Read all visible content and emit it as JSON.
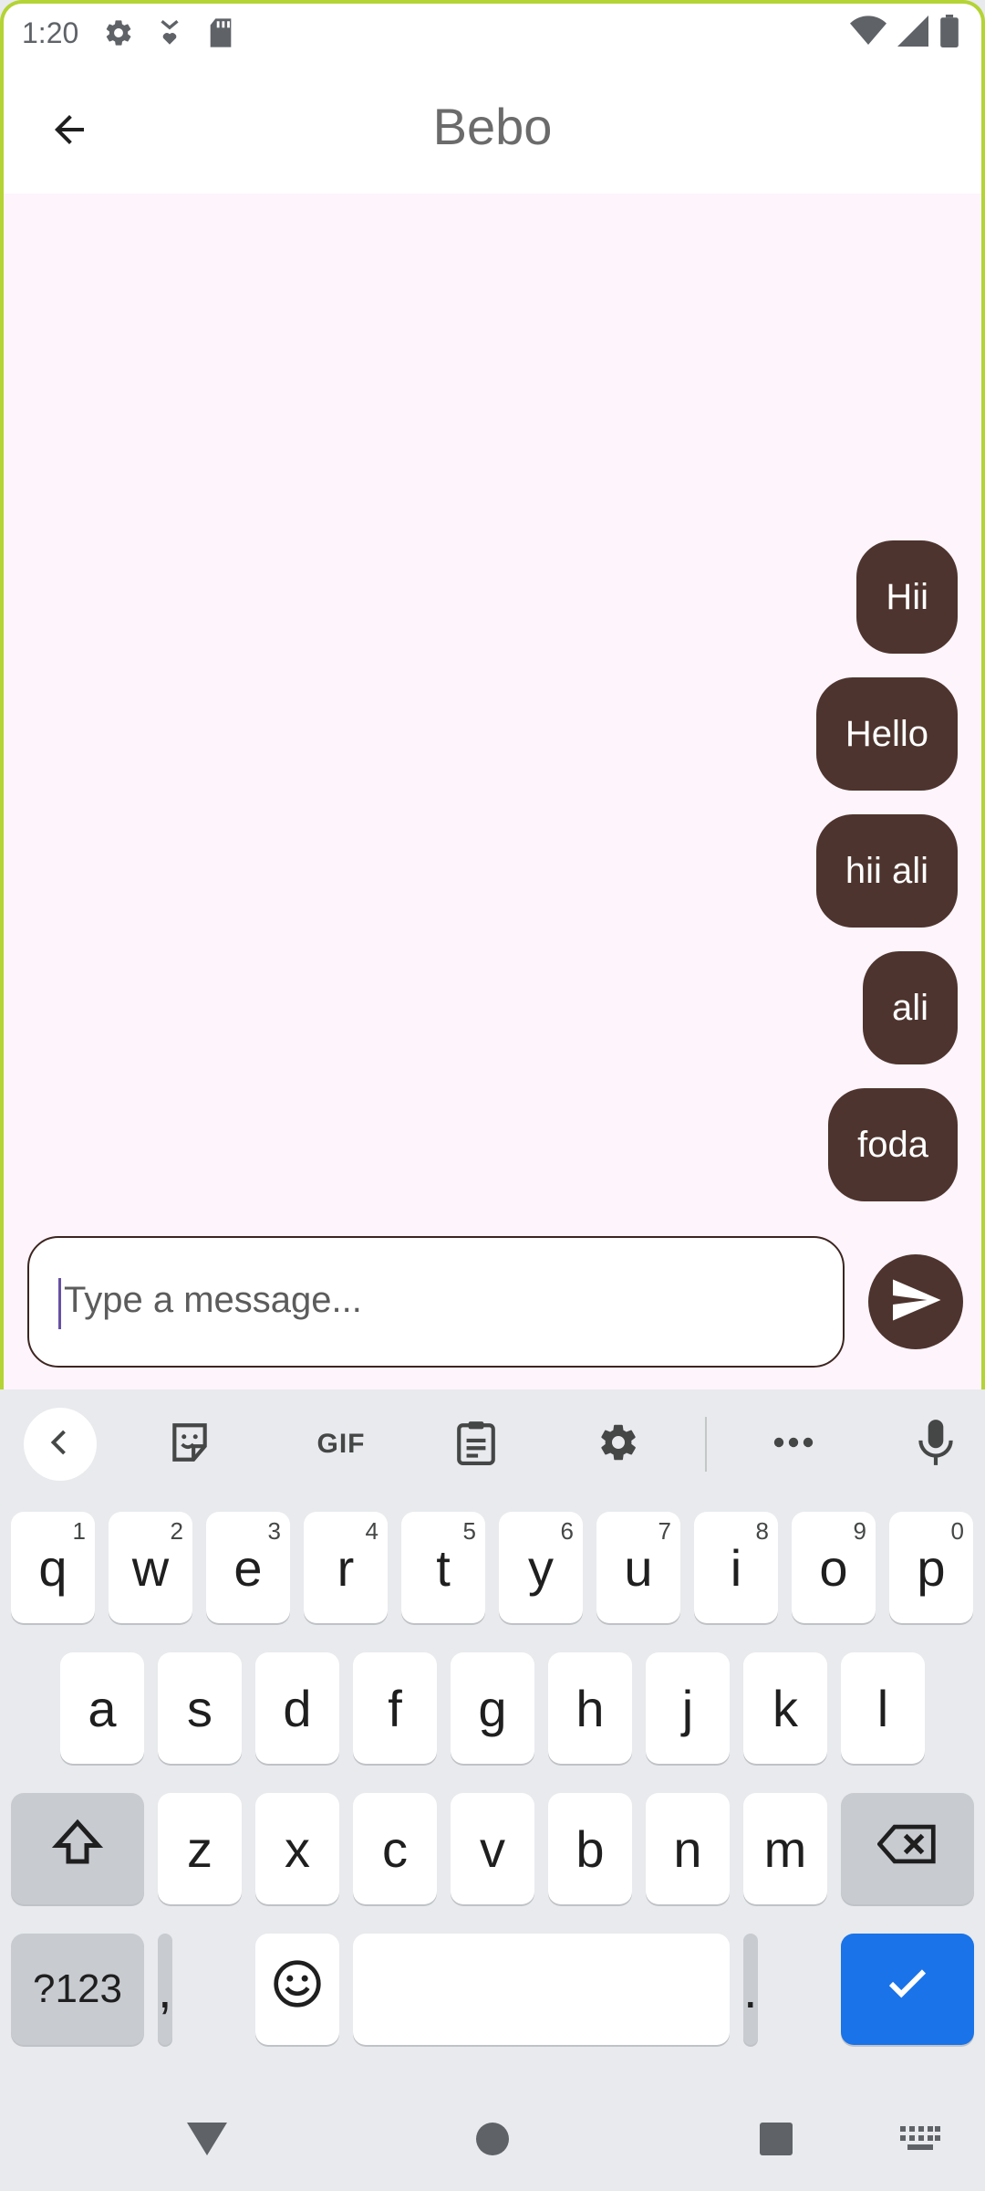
{
  "status_bar": {
    "time": "1:20"
  },
  "app_bar": {
    "title": "Bebo"
  },
  "messages": [
    {
      "text": "Hii"
    },
    {
      "text": "Hello"
    },
    {
      "text": "hii ali"
    },
    {
      "text": "ali"
    },
    {
      "text": "foda"
    }
  ],
  "composer": {
    "placeholder": "Type a message..."
  },
  "keyboard": {
    "toolbar": {
      "gif_label": "GIF"
    },
    "row1": [
      {
        "key": "q",
        "hint": "1"
      },
      {
        "key": "w",
        "hint": "2"
      },
      {
        "key": "e",
        "hint": "3"
      },
      {
        "key": "r",
        "hint": "4"
      },
      {
        "key": "t",
        "hint": "5"
      },
      {
        "key": "y",
        "hint": "6"
      },
      {
        "key": "u",
        "hint": "7"
      },
      {
        "key": "i",
        "hint": "8"
      },
      {
        "key": "o",
        "hint": "9"
      },
      {
        "key": "p",
        "hint": "0"
      }
    ],
    "row2": [
      "a",
      "s",
      "d",
      "f",
      "g",
      "h",
      "j",
      "k",
      "l"
    ],
    "row3": [
      "z",
      "x",
      "c",
      "v",
      "b",
      "n",
      "m"
    ],
    "row4": {
      "symbols_label": "?123",
      "comma": ",",
      "period": "."
    }
  },
  "colors": {
    "bubble": "#4e342e",
    "chat_background": "#fdf4fc",
    "accent_border": "#b4d335",
    "enter_key": "#1a73e8"
  }
}
